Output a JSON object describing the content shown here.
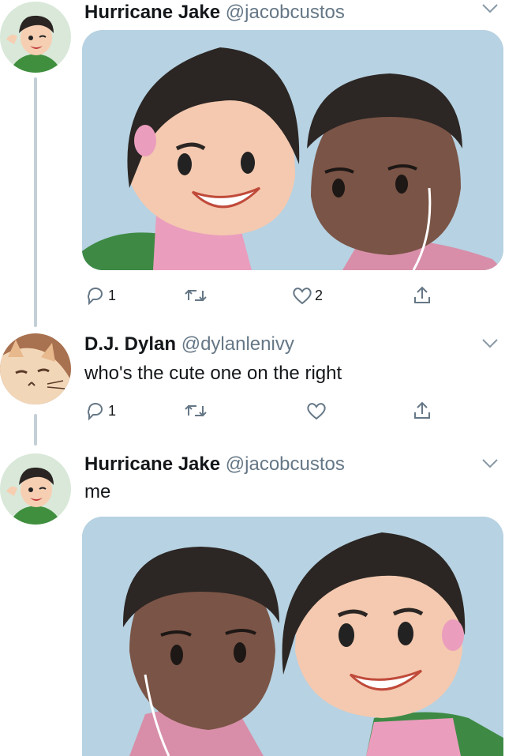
{
  "tweets": [
    {
      "display_name": "Hurricane Jake",
      "handle": "@jacobcustos",
      "text": "",
      "actions": {
        "replies": "1",
        "retweets": "",
        "likes": "2"
      }
    },
    {
      "display_name": "D.J. Dylan",
      "handle": "@dylanlenivy",
      "text": "who's the cute one on the right",
      "actions": {
        "replies": "1",
        "retweets": "",
        "likes": ""
      }
    },
    {
      "display_name": "Hurricane Jake",
      "handle": "@jacobcustos",
      "text": "me",
      "actions": {
        "replies": "",
        "retweets": "",
        "likes": ""
      }
    }
  ],
  "icons": [
    "reply-icon",
    "retweet-icon",
    "like-icon",
    "share-icon",
    "caret-down-icon"
  ],
  "colors": {
    "text": "#14171a",
    "secondary": "#657786",
    "icon": "#657786",
    "thread_line": "#c4cfd6",
    "media_bg": "#b7d2e2"
  }
}
